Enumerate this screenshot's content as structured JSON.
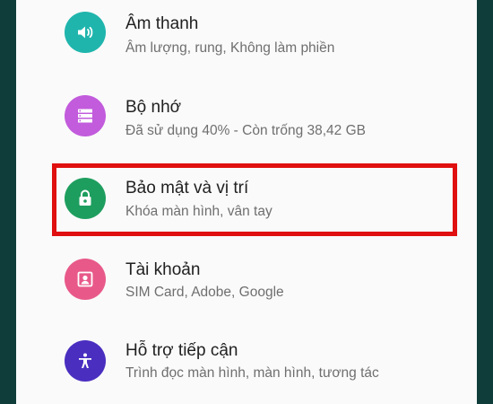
{
  "settings": {
    "items": [
      {
        "title": "Âm thanh",
        "subtitle": "Âm lượng, rung, Không làm phiền",
        "icon": "volume-icon",
        "color": "#1fb5ad"
      },
      {
        "title": "Bộ nhớ",
        "subtitle": "Đã sử dụng 40% - Còn trống 38,42 GB",
        "icon": "storage-icon",
        "color": "#c25bdc"
      },
      {
        "title": "Bảo mật và vị trí",
        "subtitle": "Khóa màn hình, vân tay",
        "icon": "lock-icon",
        "color": "#1e9e5e"
      },
      {
        "title": "Tài khoản",
        "subtitle": "SIM Card, Adobe, Google",
        "icon": "account-icon",
        "color": "#e8598a"
      },
      {
        "title": "Hỗ trợ tiếp cận",
        "subtitle": "Trình đọc màn hình, màn hình, tương tác",
        "icon": "accessibility-icon",
        "color": "#4a2ec0"
      }
    ]
  },
  "colors": {
    "background": "#0f3d3a",
    "panel": "#fafafa",
    "highlight": "#e01010"
  }
}
